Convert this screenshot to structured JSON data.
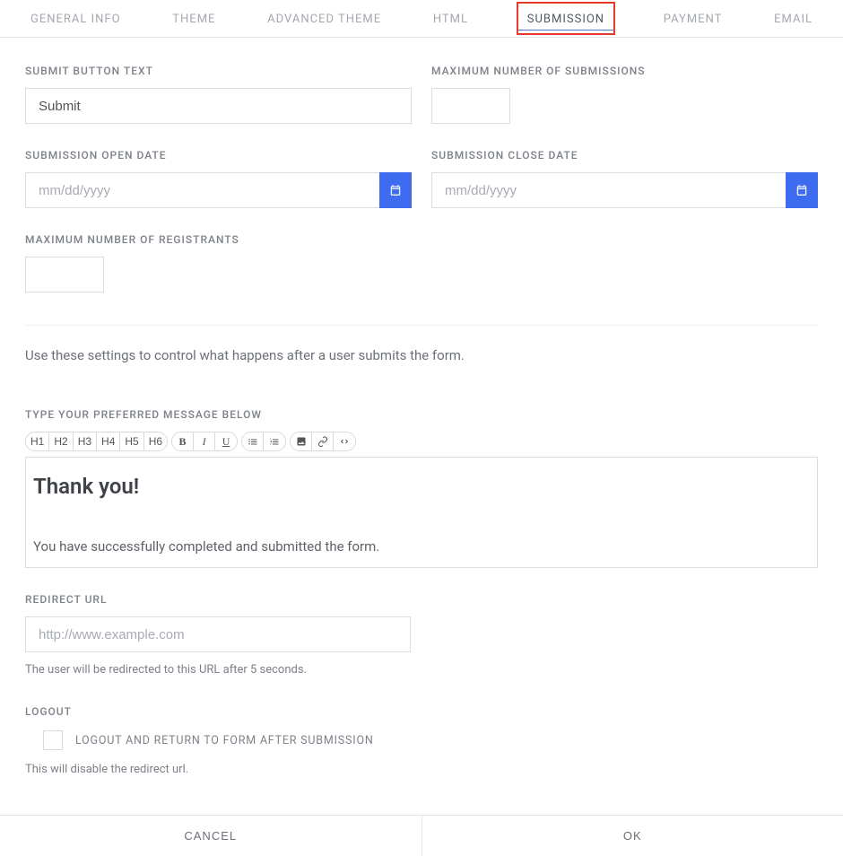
{
  "tabs": [
    {
      "id": "general",
      "label": "GENERAL INFO"
    },
    {
      "id": "theme",
      "label": "THEME"
    },
    {
      "id": "adv",
      "label": "ADVANCED THEME"
    },
    {
      "id": "html",
      "label": "HTML"
    },
    {
      "id": "submission",
      "label": "SUBMISSION"
    },
    {
      "id": "payment",
      "label": "PAYMENT"
    },
    {
      "id": "email",
      "label": "EMAIL"
    }
  ],
  "active_tab": "submission",
  "fields": {
    "submit_btn": {
      "label": "SUBMIT BUTTON TEXT",
      "value": "Submit"
    },
    "max_submissions": {
      "label": "MAXIMUM NUMBER OF SUBMISSIONS",
      "value": ""
    },
    "open_date": {
      "label": "SUBMISSION OPEN DATE",
      "placeholder": "mm/dd/yyyy",
      "value": ""
    },
    "close_date": {
      "label": "SUBMISSION CLOSE DATE",
      "placeholder": "mm/dd/yyyy",
      "value": ""
    },
    "max_registrants": {
      "label": "MAXIMUM NUMBER OF REGISTRANTS",
      "value": ""
    },
    "description": "Use these settings to control what happens after a user submits the form.",
    "message": {
      "label": "TYPE YOUR PREFERRED MESSAGE BELOW",
      "heading": "Thank you!",
      "body": "You have successfully completed and submitted the form."
    },
    "redirect": {
      "label": "REDIRECT URL",
      "placeholder": "http://www.example.com",
      "value": "",
      "help": "The user will be redirected to this URL after 5 seconds."
    },
    "logout": {
      "label": "LOGOUT",
      "checkbox_label": "LOGOUT AND RETURN TO FORM AFTER SUBMISSION",
      "help": "This will disable the redirect url."
    }
  },
  "toolbar": {
    "headings": [
      "H1",
      "H2",
      "H3",
      "H4",
      "H5",
      "H6"
    ],
    "bold": "B",
    "italic": "I",
    "underline": "U"
  },
  "footer": {
    "cancel": "CANCEL",
    "ok": "OK"
  }
}
